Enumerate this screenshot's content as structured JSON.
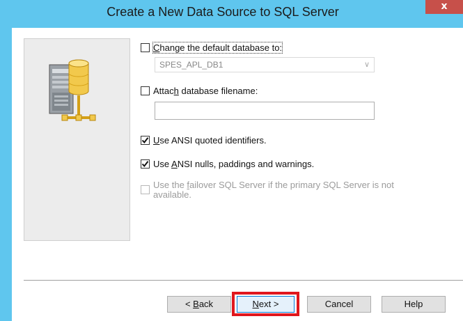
{
  "window": {
    "title": "Create a New Data Source to SQL Server",
    "close_label": "x"
  },
  "options": {
    "change_db": {
      "label_pre": "",
      "label_u": "C",
      "label_post": "hange the default database to:",
      "checked": false
    },
    "db_combo": {
      "value": "SPES_APL_DB1"
    },
    "attach_db": {
      "label_pre": "Attac",
      "label_u": "h",
      "label_post": " database filename:",
      "checked": false
    },
    "attach_field": {
      "value": ""
    },
    "ansi_quoted": {
      "label_pre": "",
      "label_u": "U",
      "label_post": "se ANSI quoted identifiers.",
      "checked": true
    },
    "ansi_nulls": {
      "label_pre": "Use ",
      "label_u": "A",
      "label_post": "NSI nulls, paddings and warnings.",
      "checked": true
    },
    "failover": {
      "label_pre": "Use the ",
      "label_u": "f",
      "label_post": "ailover SQL Server if the primary SQL Server is not available.",
      "checked": false,
      "disabled": true
    }
  },
  "buttons": {
    "back": {
      "pre": "< ",
      "u": "B",
      "post": "ack"
    },
    "next": {
      "pre": "",
      "u": "N",
      "post": "ext >"
    },
    "cancel": "Cancel",
    "help": "Help"
  }
}
